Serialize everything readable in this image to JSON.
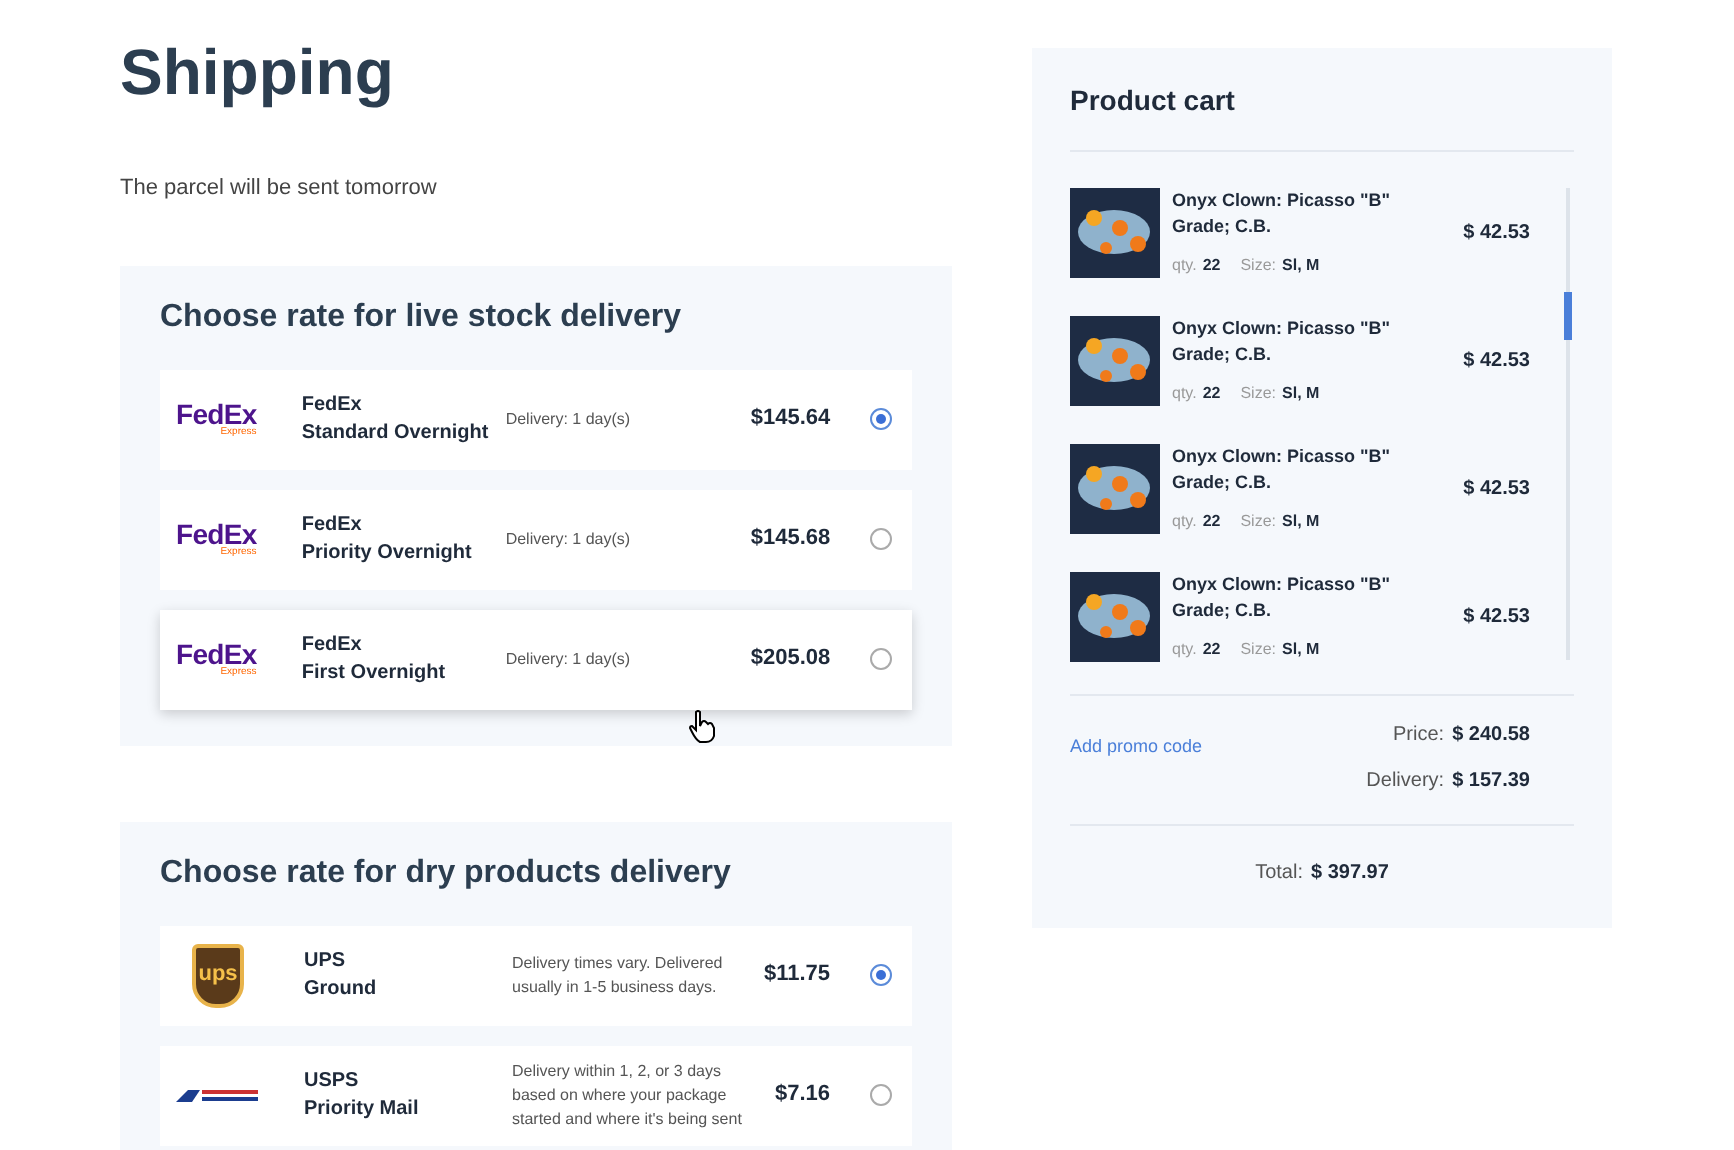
{
  "title": "Shipping",
  "subtitle": "The parcel will be sent tomorrow",
  "sections": [
    {
      "heading": "Choose rate for live stock delivery",
      "rates": [
        {
          "logo": {
            "kind": "fedex",
            "text": "FedEx",
            "sub": "Express"
          },
          "carrier": "FedEx",
          "service": "Standard Overnight",
          "delivery": "Delivery: 1 day(s)",
          "price": "$145.64",
          "selected": true,
          "hovered": false
        },
        {
          "logo": {
            "kind": "fedex",
            "text": "FedEx",
            "sub": "Express"
          },
          "carrier": "FedEx",
          "service": "Priority Overnight",
          "delivery": "Delivery: 1 day(s)",
          "price": "$145.68",
          "selected": false,
          "hovered": false
        },
        {
          "logo": {
            "kind": "fedex",
            "text": "FedEx",
            "sub": "Express"
          },
          "carrier": "FedEx",
          "service": "First Overnight",
          "delivery": "Delivery: 1 day(s)",
          "price": "$205.08",
          "selected": false,
          "hovered": true
        }
      ]
    },
    {
      "heading": "Choose rate for dry products delivery",
      "rates": [
        {
          "logo": {
            "kind": "ups",
            "text": "ups"
          },
          "carrier": "UPS",
          "service": "Ground",
          "delivery": "Delivery times vary. Delivered usually in 1-5 business days.",
          "price": "$11.75",
          "selected": true,
          "hovered": false
        },
        {
          "logo": {
            "kind": "usps"
          },
          "carrier": "USPS",
          "service": "Priority Mail",
          "delivery": "Delivery within 1, 2, or 3 days based on where your package started and where it's being sent",
          "price": "$7.16",
          "selected": false,
          "hovered": false
        }
      ]
    }
  ],
  "cart": {
    "title": "Product cart",
    "items": [
      {
        "name": "Onyx Clown: Picasso \"B\" Grade; C.B.",
        "qty_label": "qty.",
        "qty": "22",
        "size_label": "Size:",
        "size": "Sl, M",
        "price": "$ 42.53"
      },
      {
        "name": "Onyx Clown: Picasso \"B\" Grade; C.B.",
        "qty_label": "qty.",
        "qty": "22",
        "size_label": "Size:",
        "size": "Sl, M",
        "price": "$ 42.53"
      },
      {
        "name": "Onyx Clown: Picasso \"B\" Grade; C.B.",
        "qty_label": "qty.",
        "qty": "22",
        "size_label": "Size:",
        "size": "Sl, M",
        "price": "$ 42.53"
      },
      {
        "name": "Onyx Clown: Picasso \"B\" Grade; C.B.",
        "qty_label": "qty.",
        "qty": "22",
        "size_label": "Size:",
        "size": "Sl, M",
        "price": "$ 42.53"
      }
    ],
    "promo_link": "Add promo code",
    "totals": [
      {
        "label": "Price:",
        "value": "$ 240.58"
      },
      {
        "label": "Delivery:",
        "value": "$ 157.39"
      }
    ],
    "total": {
      "label": "Total:",
      "value": "$ 397.97"
    }
  }
}
